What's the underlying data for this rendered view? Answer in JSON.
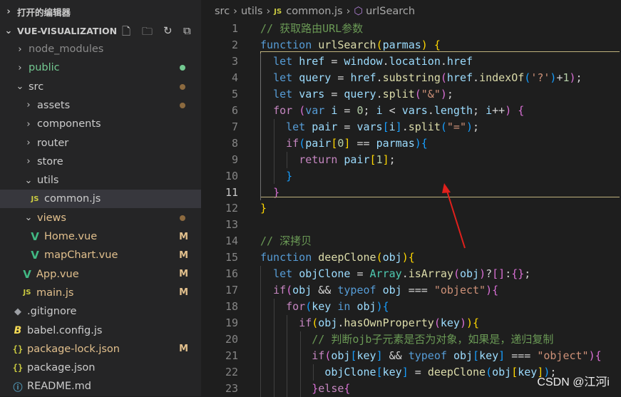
{
  "sidebar": {
    "open_editors_title": "打开的编辑器",
    "project_title": "VUE-VISUALIZATION",
    "toolbar_icons": [
      "new-file-icon",
      "new-folder-icon",
      "refresh-icon",
      "collapse-all-icon"
    ],
    "items": [
      {
        "label": "node_modules",
        "type": "folder",
        "expanded": false,
        "color": "#8b8b8b"
      },
      {
        "label": "public",
        "type": "folder",
        "expanded": false,
        "color": "#73c991",
        "dot": "#73c991"
      },
      {
        "label": "src",
        "type": "folder",
        "expanded": true,
        "color": "#cccccc",
        "dot": "#8c6a3f"
      },
      {
        "label": "assets",
        "type": "folder",
        "expanded": false,
        "color": "#cccccc",
        "dot": "#8c6a3f"
      },
      {
        "label": "components",
        "type": "folder",
        "expanded": false,
        "color": "#cccccc"
      },
      {
        "label": "router",
        "type": "folder",
        "expanded": false,
        "color": "#cccccc"
      },
      {
        "label": "store",
        "type": "folder",
        "expanded": false,
        "color": "#cccccc"
      },
      {
        "label": "utils",
        "type": "folder",
        "expanded": true,
        "color": "#cccccc"
      },
      {
        "label": "common.js",
        "type": "js",
        "color": "#cccccc",
        "icon": "JS"
      },
      {
        "label": "views",
        "type": "folder",
        "expanded": true,
        "color": "#e2c08d",
        "dot": "#8c6a3f"
      },
      {
        "label": "Home.vue",
        "type": "vue",
        "color": "#e2c08d",
        "badge": "M"
      },
      {
        "label": "mapChart.vue",
        "type": "vue",
        "color": "#e2c08d",
        "badge": "M"
      },
      {
        "label": "App.vue",
        "type": "vue",
        "color": "#e2c08d",
        "badge": "M"
      },
      {
        "label": "main.js",
        "type": "js",
        "color": "#e2c08d",
        "badge": "M",
        "icon": "JS"
      },
      {
        "label": ".gitignore",
        "type": "git",
        "color": "#cccccc"
      },
      {
        "label": "babel.config.js",
        "type": "babel",
        "color": "#cccccc"
      },
      {
        "label": "package-lock.json",
        "type": "json",
        "color": "#e2c08d",
        "badge": "M",
        "icon": "{}"
      },
      {
        "label": "package.json",
        "type": "json",
        "color": "#cccccc",
        "icon": "{}"
      },
      {
        "label": "README.md",
        "type": "info",
        "color": "#cccccc"
      }
    ]
  },
  "breadcrumb": {
    "parts": [
      "src",
      "utils",
      "common.js",
      "urlSearch"
    ],
    "js_icon": "JS"
  },
  "editor": {
    "active_line": 11,
    "lines": [
      {
        "n": "1",
        "tokens": [
          [
            "cm",
            "// 获取路由URL参数"
          ]
        ]
      },
      {
        "n": "2",
        "tokens": [
          [
            "k",
            "function"
          ],
          [
            "p",
            " "
          ],
          [
            "f",
            "urlSearch"
          ],
          [
            "b1",
            "("
          ],
          [
            "v",
            "parmas"
          ],
          [
            "b1",
            ")"
          ],
          [
            "p",
            " "
          ],
          [
            "b1",
            "{"
          ]
        ]
      },
      {
        "n": "3",
        "tokens": [
          [
            "p",
            "  "
          ],
          [
            "k",
            "let"
          ],
          [
            "p",
            " "
          ],
          [
            "v",
            "href"
          ],
          [
            "p",
            " = "
          ],
          [
            "v",
            "window"
          ],
          [
            "p",
            "."
          ],
          [
            "v",
            "location"
          ],
          [
            "p",
            "."
          ],
          [
            "v",
            "href"
          ]
        ]
      },
      {
        "n": "4",
        "tokens": [
          [
            "p",
            "  "
          ],
          [
            "k",
            "let"
          ],
          [
            "p",
            " "
          ],
          [
            "v",
            "query"
          ],
          [
            "p",
            " = "
          ],
          [
            "v",
            "href"
          ],
          [
            "p",
            "."
          ],
          [
            "f",
            "substring"
          ],
          [
            "b2",
            "("
          ],
          [
            "v",
            "href"
          ],
          [
            "p",
            "."
          ],
          [
            "f",
            "indexOf"
          ],
          [
            "b3",
            "("
          ],
          [
            "s",
            "'?'"
          ],
          [
            "b3",
            ")"
          ],
          [
            "p",
            "+"
          ],
          [
            "n",
            "1"
          ],
          [
            "b2",
            ")"
          ],
          [
            "p",
            ";"
          ]
        ]
      },
      {
        "n": "5",
        "tokens": [
          [
            "p",
            "  "
          ],
          [
            "k",
            "let"
          ],
          [
            "p",
            " "
          ],
          [
            "v",
            "vars"
          ],
          [
            "p",
            " = "
          ],
          [
            "v",
            "query"
          ],
          [
            "p",
            "."
          ],
          [
            "f",
            "split"
          ],
          [
            "b2",
            "("
          ],
          [
            "s",
            "\"&\""
          ],
          [
            "b2",
            ")"
          ],
          [
            "p",
            ";"
          ]
        ]
      },
      {
        "n": "6",
        "tokens": [
          [
            "p",
            "  "
          ],
          [
            "c",
            "for"
          ],
          [
            "p",
            " "
          ],
          [
            "b2",
            "("
          ],
          [
            "k",
            "var"
          ],
          [
            "p",
            " "
          ],
          [
            "v",
            "i"
          ],
          [
            "p",
            " = "
          ],
          [
            "n",
            "0"
          ],
          [
            "p",
            "; "
          ],
          [
            "v",
            "i"
          ],
          [
            "p",
            " < "
          ],
          [
            "v",
            "vars"
          ],
          [
            "p",
            "."
          ],
          [
            "v",
            "length"
          ],
          [
            "p",
            "; "
          ],
          [
            "v",
            "i"
          ],
          [
            "p",
            "++"
          ],
          [
            "b2",
            ")"
          ],
          [
            "p",
            " "
          ],
          [
            "b2",
            "{"
          ]
        ]
      },
      {
        "n": "7",
        "tokens": [
          [
            "p",
            "    "
          ],
          [
            "k",
            "let"
          ],
          [
            "p",
            " "
          ],
          [
            "v",
            "pair"
          ],
          [
            "p",
            " = "
          ],
          [
            "v",
            "vars"
          ],
          [
            "b3",
            "["
          ],
          [
            "v",
            "i"
          ],
          [
            "b3",
            "]"
          ],
          [
            "p",
            "."
          ],
          [
            "f",
            "split"
          ],
          [
            "b3",
            "("
          ],
          [
            "s",
            "\"=\""
          ],
          [
            "b3",
            ")"
          ],
          [
            "p",
            ";"
          ]
        ]
      },
      {
        "n": "8",
        "tokens": [
          [
            "p",
            "    "
          ],
          [
            "c",
            "if"
          ],
          [
            "b3",
            "("
          ],
          [
            "v",
            "pair"
          ],
          [
            "b1",
            "["
          ],
          [
            "n",
            "0"
          ],
          [
            "b1",
            "]"
          ],
          [
            "p",
            " == "
          ],
          [
            "v",
            "parmas"
          ],
          [
            "b3",
            ")"
          ],
          [
            "b3",
            "{"
          ]
        ]
      },
      {
        "n": "9",
        "tokens": [
          [
            "p",
            "      "
          ],
          [
            "c",
            "return"
          ],
          [
            "p",
            " "
          ],
          [
            "v",
            "pair"
          ],
          [
            "b1",
            "["
          ],
          [
            "n",
            "1"
          ],
          [
            "b1",
            "]"
          ],
          [
            "p",
            ";"
          ]
        ]
      },
      {
        "n": "10",
        "tokens": [
          [
            "p",
            "    "
          ],
          [
            "b3",
            "}"
          ]
        ]
      },
      {
        "n": "11",
        "tokens": [
          [
            "p",
            "  "
          ],
          [
            "b2",
            "}"
          ]
        ]
      },
      {
        "n": "12",
        "tokens": [
          [
            "b1",
            "}"
          ]
        ]
      },
      {
        "n": "13",
        "tokens": []
      },
      {
        "n": "14",
        "tokens": [
          [
            "cm",
            "// 深拷贝"
          ]
        ]
      },
      {
        "n": "15",
        "tokens": [
          [
            "k",
            "function"
          ],
          [
            "p",
            " "
          ],
          [
            "f",
            "deepClone"
          ],
          [
            "b1",
            "("
          ],
          [
            "v",
            "obj"
          ],
          [
            "b1",
            ")"
          ],
          [
            "b1",
            "{"
          ]
        ]
      },
      {
        "n": "16",
        "tokens": [
          [
            "p",
            "  "
          ],
          [
            "k",
            "let"
          ],
          [
            "p",
            " "
          ],
          [
            "v",
            "objClone"
          ],
          [
            "p",
            " = "
          ],
          [
            "t",
            "Array"
          ],
          [
            "p",
            "."
          ],
          [
            "f",
            "isArray"
          ],
          [
            "b2",
            "("
          ],
          [
            "v",
            "obj"
          ],
          [
            "b2",
            ")"
          ],
          [
            "p",
            "?"
          ],
          [
            "b2",
            "["
          ],
          [
            "b2",
            "]"
          ],
          [
            "p",
            ":"
          ],
          [
            "b2",
            "{"
          ],
          [
            "b2",
            "}"
          ],
          [
            "p",
            ";"
          ]
        ]
      },
      {
        "n": "17",
        "tokens": [
          [
            "p",
            "  "
          ],
          [
            "c",
            "if"
          ],
          [
            "b2",
            "("
          ],
          [
            "v",
            "obj"
          ],
          [
            "p",
            " && "
          ],
          [
            "k",
            "typeof"
          ],
          [
            "p",
            " "
          ],
          [
            "v",
            "obj"
          ],
          [
            "p",
            " === "
          ],
          [
            "s",
            "\"object\""
          ],
          [
            "b2",
            ")"
          ],
          [
            "b2",
            "{"
          ]
        ]
      },
      {
        "n": "18",
        "tokens": [
          [
            "p",
            "    "
          ],
          [
            "c",
            "for"
          ],
          [
            "b3",
            "("
          ],
          [
            "v",
            "key"
          ],
          [
            "p",
            " "
          ],
          [
            "k",
            "in"
          ],
          [
            "p",
            " "
          ],
          [
            "v",
            "obj"
          ],
          [
            "b3",
            ")"
          ],
          [
            "b3",
            "{"
          ]
        ]
      },
      {
        "n": "19",
        "tokens": [
          [
            "p",
            "      "
          ],
          [
            "c",
            "if"
          ],
          [
            "b1",
            "("
          ],
          [
            "v",
            "obj"
          ],
          [
            "p",
            "."
          ],
          [
            "f",
            "hasOwnProperty"
          ],
          [
            "b2",
            "("
          ],
          [
            "v",
            "key"
          ],
          [
            "b2",
            ")"
          ],
          [
            "b1",
            ")"
          ],
          [
            "b1",
            "{"
          ]
        ]
      },
      {
        "n": "20",
        "tokens": [
          [
            "p",
            "        "
          ],
          [
            "cm",
            "// 判断ojb子元素是否为对象，如果是，递归复制"
          ]
        ]
      },
      {
        "n": "21",
        "tokens": [
          [
            "p",
            "        "
          ],
          [
            "c",
            "if"
          ],
          [
            "b2",
            "("
          ],
          [
            "v",
            "obj"
          ],
          [
            "b3",
            "["
          ],
          [
            "v",
            "key"
          ],
          [
            "b3",
            "]"
          ],
          [
            "p",
            " && "
          ],
          [
            "k",
            "typeof"
          ],
          [
            "p",
            " "
          ],
          [
            "v",
            "obj"
          ],
          [
            "b3",
            "["
          ],
          [
            "v",
            "key"
          ],
          [
            "b3",
            "]"
          ],
          [
            "p",
            " === "
          ],
          [
            "s",
            "\"object\""
          ],
          [
            "b2",
            ")"
          ],
          [
            "b2",
            "{"
          ]
        ]
      },
      {
        "n": "22",
        "tokens": [
          [
            "p",
            "          "
          ],
          [
            "v",
            "objClone"
          ],
          [
            "b3",
            "["
          ],
          [
            "v",
            "key"
          ],
          [
            "b3",
            "]"
          ],
          [
            "p",
            " = "
          ],
          [
            "f",
            "deepClone"
          ],
          [
            "b3",
            "("
          ],
          [
            "v",
            "obj"
          ],
          [
            "b1",
            "["
          ],
          [
            "v",
            "key"
          ],
          [
            "b1",
            "]"
          ],
          [
            "b3",
            ")"
          ],
          [
            "p",
            ";"
          ]
        ]
      },
      {
        "n": "23",
        "tokens": [
          [
            "p",
            "        "
          ],
          [
            "b2",
            "}"
          ],
          [
            "c",
            "else"
          ],
          [
            "b2",
            "{"
          ]
        ]
      }
    ]
  },
  "watermark": "CSDN @江河i",
  "colors": {
    "annotation_arrow": "#e0201c",
    "accent_bracket_box": "#cfc08a"
  }
}
